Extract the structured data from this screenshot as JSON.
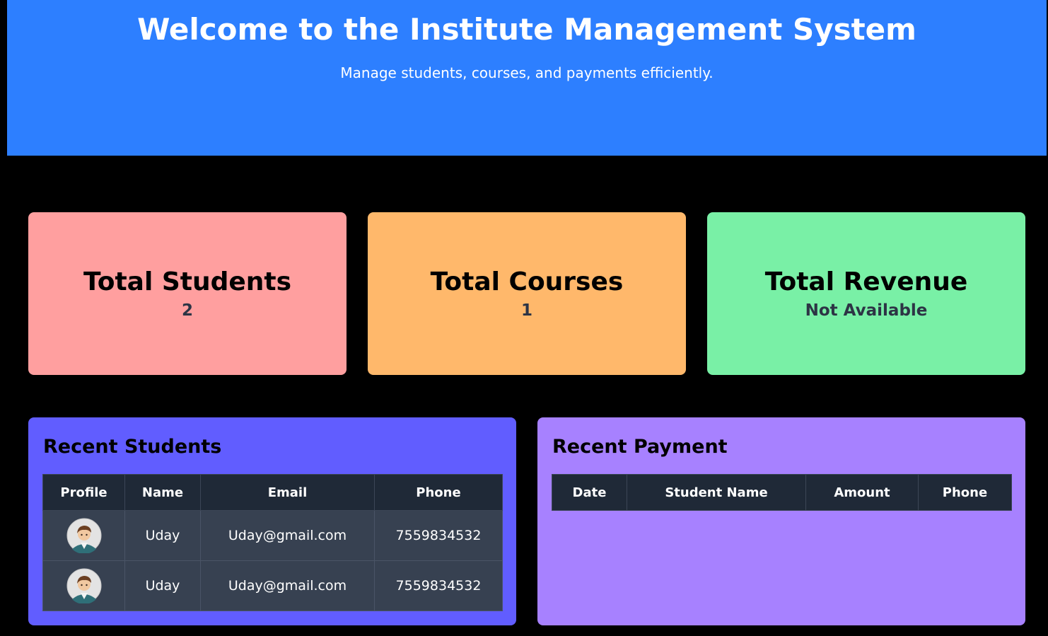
{
  "header": {
    "title": "Welcome to the Institute Management System",
    "subtitle": "Manage students, courses, and payments efficiently."
  },
  "stats": [
    {
      "label": "Total Students",
      "value": "2",
      "color": "#ff9f9f"
    },
    {
      "label": "Total Courses",
      "value": "1",
      "color": "#ffb86b"
    },
    {
      "label": "Total Revenue",
      "value": "Not Available",
      "color": "#79f0a6"
    }
  ],
  "recent_students": {
    "title": "Recent Students",
    "color": "#615dff",
    "columns": [
      "Profile",
      "Name",
      "Email",
      "Phone"
    ],
    "rows": [
      {
        "avatar": "student-avatar-icon",
        "name": "Uday",
        "email": "Uday@gmail.com",
        "phone": "7559834532"
      },
      {
        "avatar": "student-avatar-icon",
        "name": "Uday",
        "email": "Uday@gmail.com",
        "phone": "7559834532"
      }
    ]
  },
  "recent_payment": {
    "title": "Recent Payment",
    "color": "#a781ff",
    "columns": [
      "Date",
      "Student Name",
      "Amount",
      "Phone"
    ],
    "rows": []
  }
}
